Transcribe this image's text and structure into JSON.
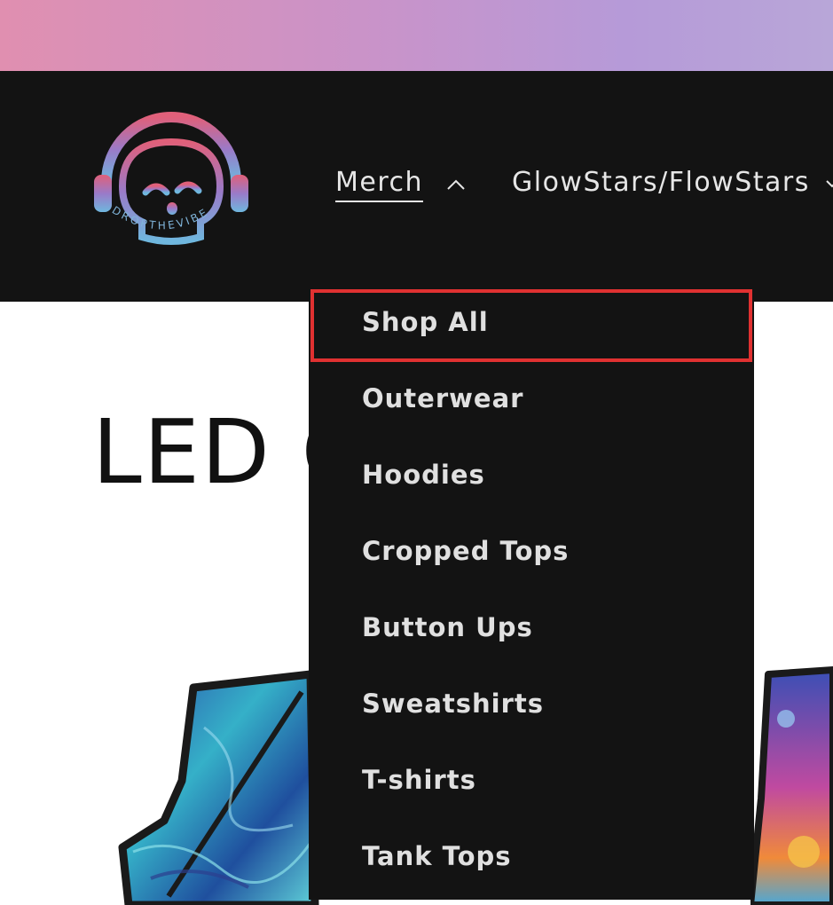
{
  "header": {
    "logo_text": "DROPTHEVIBE",
    "nav": [
      {
        "label": "Merch",
        "expanded": true
      },
      {
        "label": "GlowStars/FlowStars",
        "expanded": false
      }
    ]
  },
  "page": {
    "title": "LED C"
  },
  "merch_menu": {
    "items": [
      {
        "label": "Shop All",
        "highlighted": true
      },
      {
        "label": "Outerwear"
      },
      {
        "label": "Hoodies"
      },
      {
        "label": "Cropped Tops"
      },
      {
        "label": "Button Ups"
      },
      {
        "label": "Sweatshirts"
      },
      {
        "label": "T-shirts"
      },
      {
        "label": "Tank Tops"
      }
    ]
  },
  "colors": {
    "header_bg": "#131313",
    "highlight_border": "#e03131",
    "logo_gradient_start": "#e0607a",
    "logo_gradient_end": "#6fb7de"
  }
}
